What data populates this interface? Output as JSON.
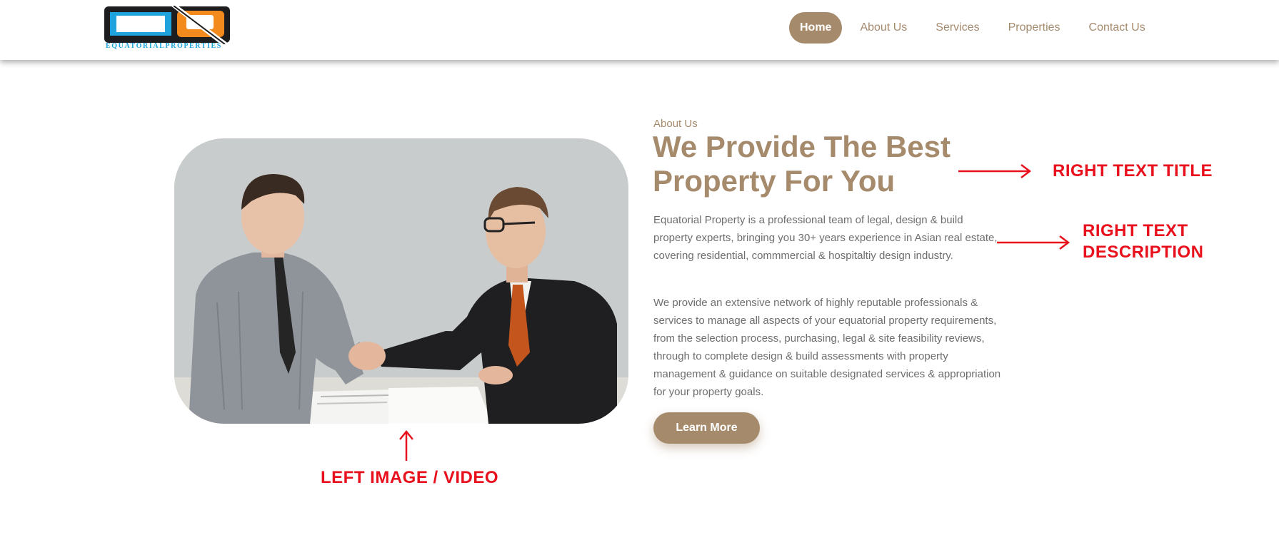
{
  "brand": {
    "logo_text": "EQUATORIALPROPERTIES",
    "colors": {
      "blue": "#1fa3dc",
      "orange": "#f28a1e",
      "dark": "#1d1d1f"
    }
  },
  "nav": {
    "items": [
      {
        "label": "Home",
        "active": true
      },
      {
        "label": "About Us"
      },
      {
        "label": "Services"
      },
      {
        "label": "Properties"
      },
      {
        "label": "Contact Us"
      }
    ]
  },
  "hero_image": {
    "icon": "handshake-photo"
  },
  "about": {
    "eyebrow": "About Us",
    "title": "We Provide The Best Property For You",
    "paragraph1": "Equatorial Property is a professional team of legal, design & build property experts, bringing you 30+ years experience in Asian real estate, covering residential, commmercial & hospitaltiy design industry.",
    "paragraph2": "We provide an extensive network of highly reputable professionals & services to manage all aspects of your equatorial property requirements, from the selection process, purchasing, legal & site feasibility reviews, through to complete design & build assessments with property management & guidance on suitable designated services & appropriation for your property goals.",
    "button_label": "Learn More"
  },
  "annotations": {
    "right_title": "RIGHT TEXT TITLE",
    "right_desc_line1": "RIGHT TEXT",
    "right_desc_line2": "DESCRIPTION",
    "left_image": "LEFT IMAGE / VIDEO"
  },
  "theme": {
    "accent": "#a68a6c",
    "annotation": "#e8101c",
    "body_text": "#6e6e6e"
  }
}
